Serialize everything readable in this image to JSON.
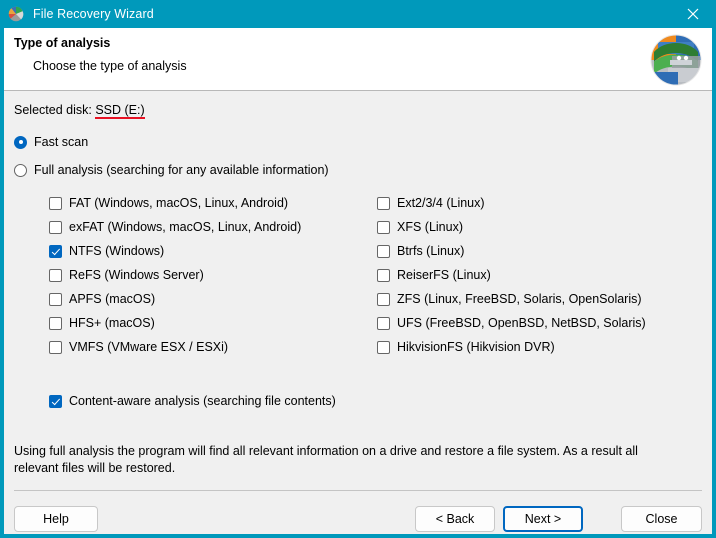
{
  "window": {
    "title": "File Recovery Wizard",
    "app_icon": "disk-pie-icon",
    "close_icon": "close-icon",
    "titlebar_color": "#0099bb",
    "accent_color": "#0067c0"
  },
  "header": {
    "title": "Type of analysis",
    "subtitle": "Choose the type of analysis",
    "logo_icon": "recovery-disk-logo"
  },
  "selected_disk": {
    "label": "Selected disk:",
    "value": "SSD (E:)",
    "underline_color": "#e81123"
  },
  "scan_modes": [
    {
      "label": "Fast scan",
      "checked": true,
      "name": "fast-scan"
    },
    {
      "label": "Full analysis (searching for any available information)",
      "checked": false,
      "name": "full-analysis"
    }
  ],
  "filesystems_left": [
    {
      "label": "FAT (Windows, macOS, Linux, Android)",
      "checked": false,
      "name": "fat"
    },
    {
      "label": "exFAT (Windows, macOS, Linux, Android)",
      "checked": false,
      "name": "exfat"
    },
    {
      "label": "NTFS (Windows)",
      "checked": true,
      "name": "ntfs"
    },
    {
      "label": "ReFS (Windows Server)",
      "checked": false,
      "name": "refs"
    },
    {
      "label": "APFS (macOS)",
      "checked": false,
      "name": "apfs"
    },
    {
      "label": "HFS+ (macOS)",
      "checked": false,
      "name": "hfs-plus"
    },
    {
      "label": "VMFS (VMware ESX / ESXi)",
      "checked": false,
      "name": "vmfs"
    }
  ],
  "filesystems_right": [
    {
      "label": "Ext2/3/4 (Linux)",
      "checked": false,
      "name": "ext234"
    },
    {
      "label": "XFS (Linux)",
      "checked": false,
      "name": "xfs"
    },
    {
      "label": "Btrfs (Linux)",
      "checked": false,
      "name": "btrfs"
    },
    {
      "label": "ReiserFS (Linux)",
      "checked": false,
      "name": "reiserfs"
    },
    {
      "label": "ZFS (Linux, FreeBSD, Solaris, OpenSolaris)",
      "checked": false,
      "name": "zfs"
    },
    {
      "label": "UFS (FreeBSD, OpenBSD, NetBSD, Solaris)",
      "checked": false,
      "name": "ufs"
    },
    {
      "label": "HikvisionFS (Hikvision DVR)",
      "checked": false,
      "name": "hikvisionfs"
    }
  ],
  "content_aware": {
    "label": "Content-aware analysis (searching file contents)",
    "checked": true
  },
  "description": "Using full analysis the program will find all relevant information on a drive and restore a file system. As a result all relevant files will be restored.",
  "footer": {
    "help": "Help",
    "back": "< Back",
    "next": "Next >",
    "close": "Close"
  }
}
